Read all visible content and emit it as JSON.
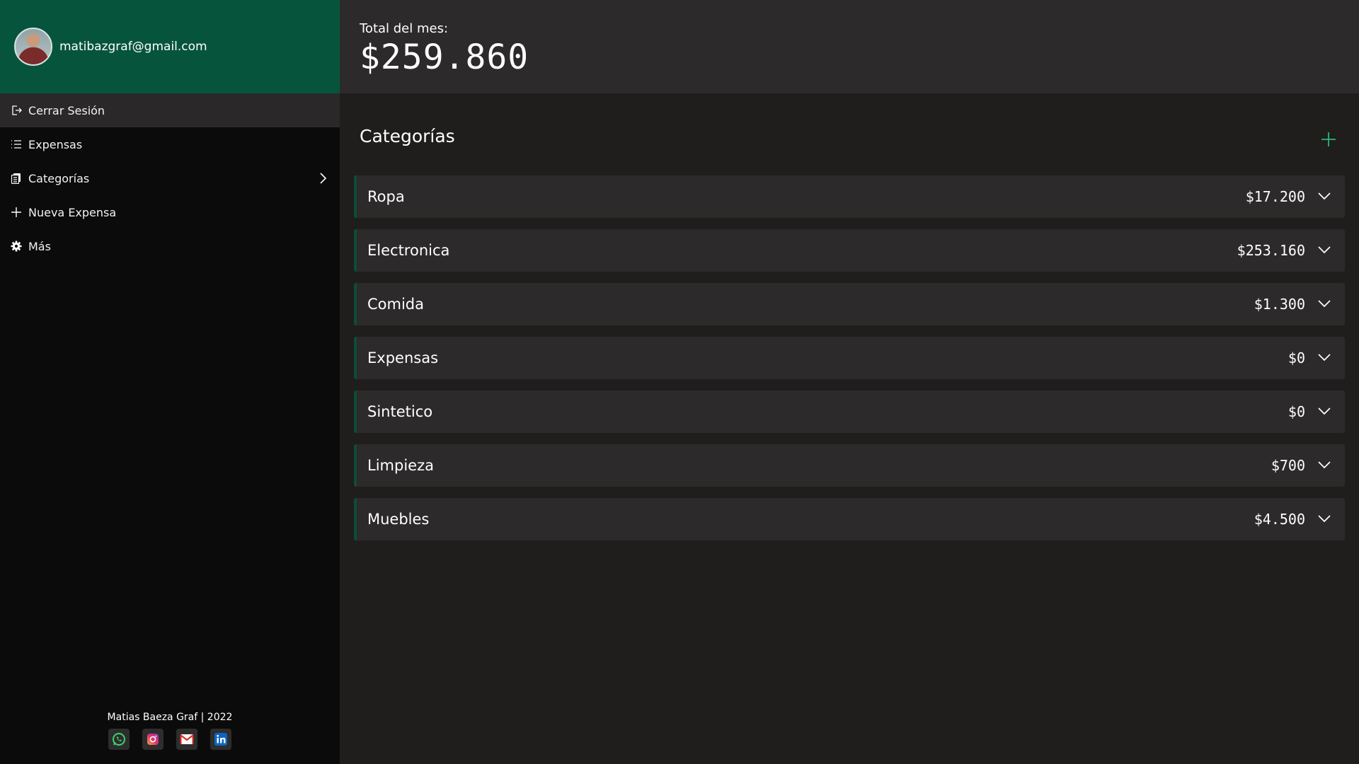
{
  "profile": {
    "email": "matibazgraf@gmail.com",
    "avatar_icon": "user-photo"
  },
  "sidebar": {
    "items": [
      {
        "label": "Cerrar Sesión",
        "icon": "logout-icon",
        "active": true
      },
      {
        "label": "Expensas",
        "icon": "list-icon",
        "active": false
      },
      {
        "label": "Categorías",
        "icon": "document-icon",
        "active": false,
        "has_chevron": true
      },
      {
        "label": "Nueva Expensa",
        "icon": "plus-icon",
        "active": false
      },
      {
        "label": "Más",
        "icon": "gear-icon",
        "active": false
      }
    ],
    "footer_text": "Matias Baeza Graf | 2022",
    "socials": [
      "whatsapp-icon",
      "instagram-icon",
      "gmail-icon",
      "linkedin-icon"
    ]
  },
  "header": {
    "total_label": "Total del mes:",
    "total_value": "$259.860"
  },
  "main": {
    "section_title": "Categorías",
    "categories": [
      {
        "name": "Ropa",
        "amount": "$17.200"
      },
      {
        "name": "Electronica",
        "amount": "$253.160"
      },
      {
        "name": "Comida",
        "amount": "$1.300"
      },
      {
        "name": "Expensas",
        "amount": "$0"
      },
      {
        "name": "Sintetico",
        "amount": "$0"
      },
      {
        "name": "Limpieza",
        "amount": "$700"
      },
      {
        "name": "Muebles",
        "amount": "$4.500"
      }
    ]
  },
  "colors": {
    "profile_bg": "#07543d",
    "accent": "#2bb673",
    "sidebar_bg": "#0b0b0b",
    "main_bg": "#201e1d",
    "row_bg": "#2c2a2a"
  }
}
